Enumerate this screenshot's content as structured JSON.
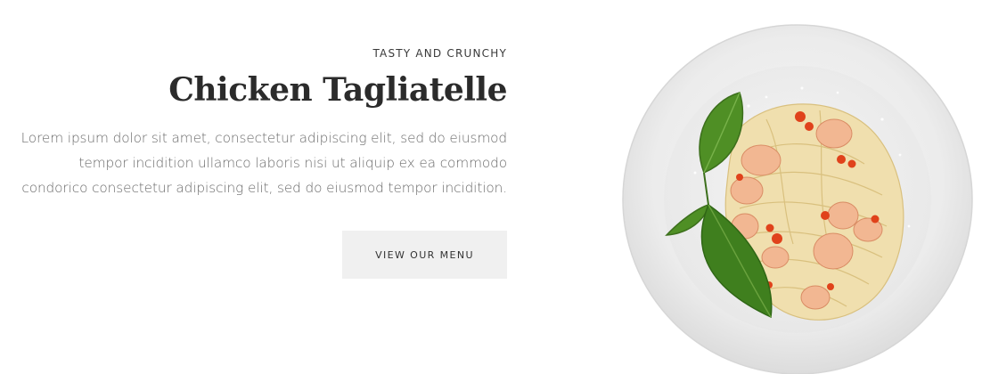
{
  "hero": {
    "eyebrow": "TASTY AND CRUNCHY",
    "title": "Chicken Tagliatelle",
    "description": "Lorem ipsum dolor sit amet, consectetur adipiscing elit, sed do eiusmod tempor incidition ullamco laboris nisi ut aliquip ex ea commodo condorico consectetur adipiscing elit, sed do eiusmod tempor incidition.",
    "button_label": "VIEW OUR MENU"
  },
  "image": {
    "subject": "plate-of-chicken-tagliatelle-with-basil"
  },
  "colors": {
    "title": "#2b2b2b",
    "body_text": "#6b6b6b",
    "button_bg": "#f0f0f0",
    "plate": "#eeeeee"
  }
}
